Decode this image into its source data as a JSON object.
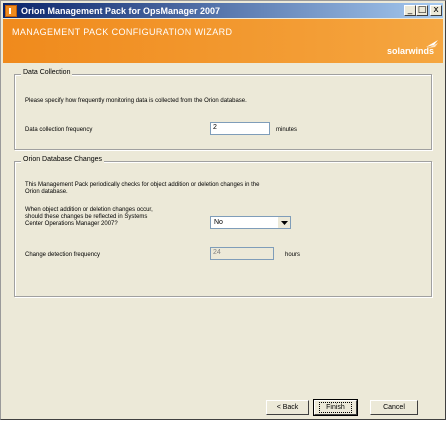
{
  "window": {
    "title": "Orion Management Pack for OpsManager 2007",
    "minimize": "_",
    "maximize": "□",
    "close": "x"
  },
  "banner": {
    "title": "MANAGEMENT PACK CONFIGURATION WIZARD",
    "brand": "solarwinds"
  },
  "data_collection": {
    "legend": "Data Collection",
    "description": "Please specify how frequently monitoring data is collected from the Orion database.",
    "frequency_label": "Data collection frequency",
    "frequency_value": "2",
    "frequency_unit": "minutes"
  },
  "orion_changes": {
    "legend": "Orion Database Changes",
    "description_line1": "This Management Pack periodically checks for object addition or deletion changes in the",
    "description_line2": "Orion database.",
    "question_line1": "When object addition or deletion changes occur,",
    "question_line2": "should these changes be reflected in Systems",
    "question_line3": "Center Operations Manager 2007?",
    "reflect_value": "No",
    "detection_label": "Change detection frequency",
    "detection_value": "24",
    "detection_unit": "hours"
  },
  "buttons": {
    "back": "< Back",
    "finish": "Finish",
    "cancel": "Cancel"
  }
}
